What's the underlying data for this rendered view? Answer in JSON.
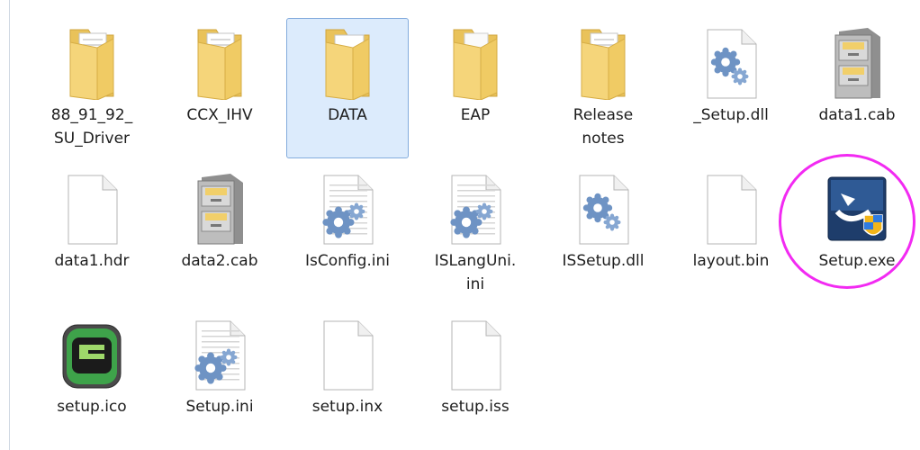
{
  "explorer": {
    "files": [
      {
        "label": "88_91_92_\nSU_Driver",
        "icon": "folder-docs-icon",
        "selected": false
      },
      {
        "label": "CCX_IHV",
        "icon": "folder-docs-icon",
        "selected": false
      },
      {
        "label": "DATA",
        "icon": "folder-image-icon",
        "selected": true
      },
      {
        "label": "EAP",
        "icon": "folder-icon",
        "selected": false
      },
      {
        "label": "Release\nnotes",
        "icon": "folder-docs-icon",
        "selected": false
      },
      {
        "label": "_Setup.dll",
        "icon": "dll-file-icon",
        "selected": false
      },
      {
        "label": "data1.cab",
        "icon": "cabinet-file-icon",
        "selected": false
      },
      {
        "label": "data1.hdr",
        "icon": "blank-file-icon",
        "selected": false
      },
      {
        "label": "data2.cab",
        "icon": "cabinet-file-icon",
        "selected": false
      },
      {
        "label": "IsConfig.ini",
        "icon": "ini-file-icon",
        "selected": false
      },
      {
        "label": "ISLangUni.\nini",
        "icon": "ini-file-icon",
        "selected": false
      },
      {
        "label": "ISSetup.dll",
        "icon": "dll-file-icon",
        "selected": false
      },
      {
        "label": "layout.bin",
        "icon": "blank-file-icon",
        "selected": false
      },
      {
        "label": "Setup.exe",
        "icon": "setup-exe-icon",
        "selected": false
      },
      {
        "label": "setup.ico",
        "icon": "ico-file-icon",
        "selected": false
      },
      {
        "label": "Setup.ini",
        "icon": "ini-file-icon",
        "selected": false
      },
      {
        "label": "setup.inx",
        "icon": "blank-file-icon",
        "selected": false
      },
      {
        "label": "setup.iss",
        "icon": "blank-file-icon",
        "selected": false
      }
    ]
  },
  "colors": {
    "selection_bg": "#dcebfc",
    "selection_border": "#84acdd",
    "annotation_circle": "#f22af2",
    "folder": "#f1cf6a"
  }
}
